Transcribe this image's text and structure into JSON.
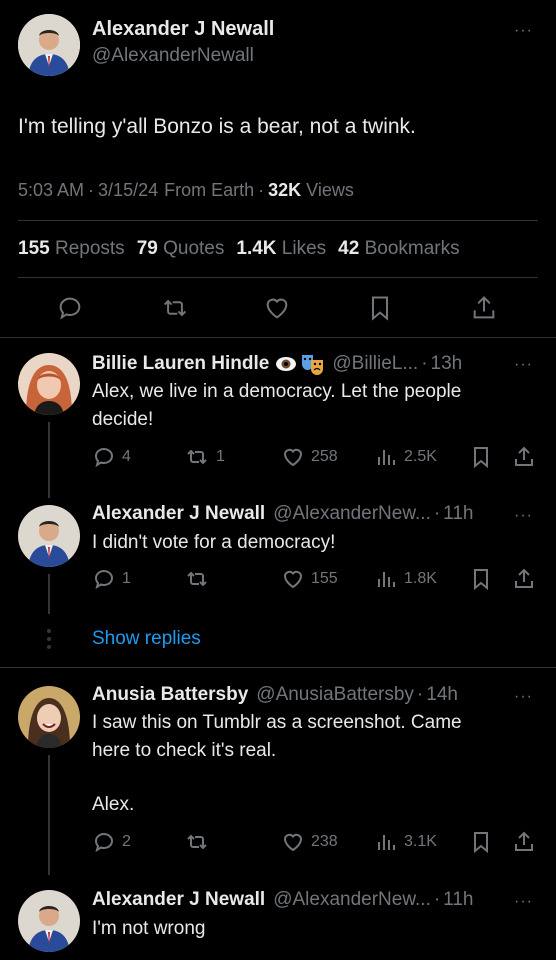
{
  "main_tweet": {
    "author_name": "Alexander J Newall",
    "author_handle": "@AlexanderNewall",
    "text": "I'm telling y'all Bonzo is a bear, not a twink.",
    "time": "5:03 AM",
    "date": "3/15/24",
    "source": "From Earth",
    "views_count": "32K",
    "views_label": "Views",
    "stats": {
      "reposts_count": "155",
      "reposts_label": "Reposts",
      "quotes_count": "79",
      "quotes_label": "Quotes",
      "likes_count": "1.4K",
      "likes_label": "Likes",
      "bookmarks_count": "42",
      "bookmarks_label": "Bookmarks"
    }
  },
  "replies": [
    {
      "author_name": "Billie Lauren Hindle",
      "author_handle": "@BillieL...",
      "time": "13h",
      "text_line1": "Alex, we live in a democracy. Let the people",
      "text_line2": "decide!",
      "replies": "4",
      "reposts": "1",
      "likes": "258",
      "views": "2.5K",
      "badges": [
        "eye-emoji",
        "theater-masks-emoji"
      ]
    },
    {
      "author_name": "Alexander J Newall",
      "author_handle": "@AlexanderNew...",
      "time": "11h",
      "text_line1": "I didn't vote for a democracy!",
      "replies": "1",
      "reposts": "",
      "likes": "155",
      "views": "1.8K"
    },
    {
      "author_name": "Anusia Battersby",
      "author_handle": "@AnusiaBattersby",
      "time": "14h",
      "text_line1": "I saw this on Tumblr as a screenshot. Came",
      "text_line2": "here to check it's real.",
      "text_line3": "Alex.",
      "replies": "2",
      "reposts": "",
      "likes": "238",
      "views": "3.1K"
    },
    {
      "author_name": "Alexander J Newall",
      "author_handle": "@AlexanderNew...",
      "time": "11h",
      "text_line1": "I'm not wrong"
    }
  ],
  "show_replies_label": "Show replies",
  "separator_dot": "·",
  "more_label": "···",
  "colors": {
    "background": "#000000",
    "text": "#e7e9ea",
    "muted": "#71767b",
    "link": "#1d9bf0",
    "divider": "#2f3336"
  }
}
